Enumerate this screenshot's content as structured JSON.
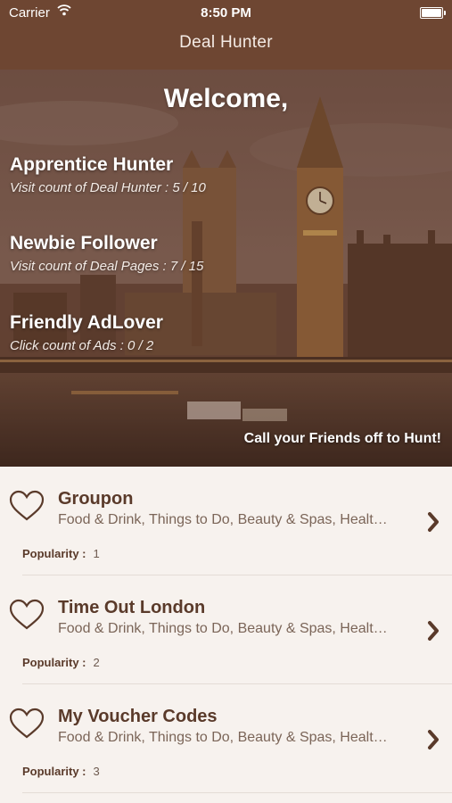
{
  "status": {
    "carrier": "Carrier",
    "time": "8:50 PM"
  },
  "nav": {
    "title": "Deal Hunter"
  },
  "hero": {
    "welcome": "Welcome,",
    "levels": [
      {
        "name": "Apprentice Hunter",
        "detail": "Visit count of Deal Hunter : 5 / 10"
      },
      {
        "name": "Newbie Follower",
        "detail": "Visit count of Deal Pages : 7 / 15"
      },
      {
        "name": "Friendly AdLover",
        "detail": "Click count of Ads : 0 / 2"
      }
    ],
    "cta": "Call your Friends off to Hunt!"
  },
  "deals": [
    {
      "name": "Groupon",
      "categories": "Food & Drink, Things to Do, Beauty & Spas, Healt…",
      "popularity_label": "Popularity :",
      "popularity": "1"
    },
    {
      "name": "Time Out London",
      "categories": "Food & Drink, Things to Do, Beauty & Spas, Healt…",
      "popularity_label": "Popularity :",
      "popularity": "2"
    },
    {
      "name": "My Voucher Codes",
      "categories": "Food & Drink, Things to Do, Beauty & Spas, Healt…",
      "popularity_label": "Popularity :",
      "popularity": "3"
    }
  ],
  "icons": {
    "heart": "heart-outline-icon",
    "chevron": "chevron-right-icon",
    "wifi": "wifi-icon",
    "battery": "battery-icon"
  },
  "colors": {
    "bar": "#6e4632",
    "accent": "#5a3a2a",
    "background": "#f7f2ee"
  }
}
